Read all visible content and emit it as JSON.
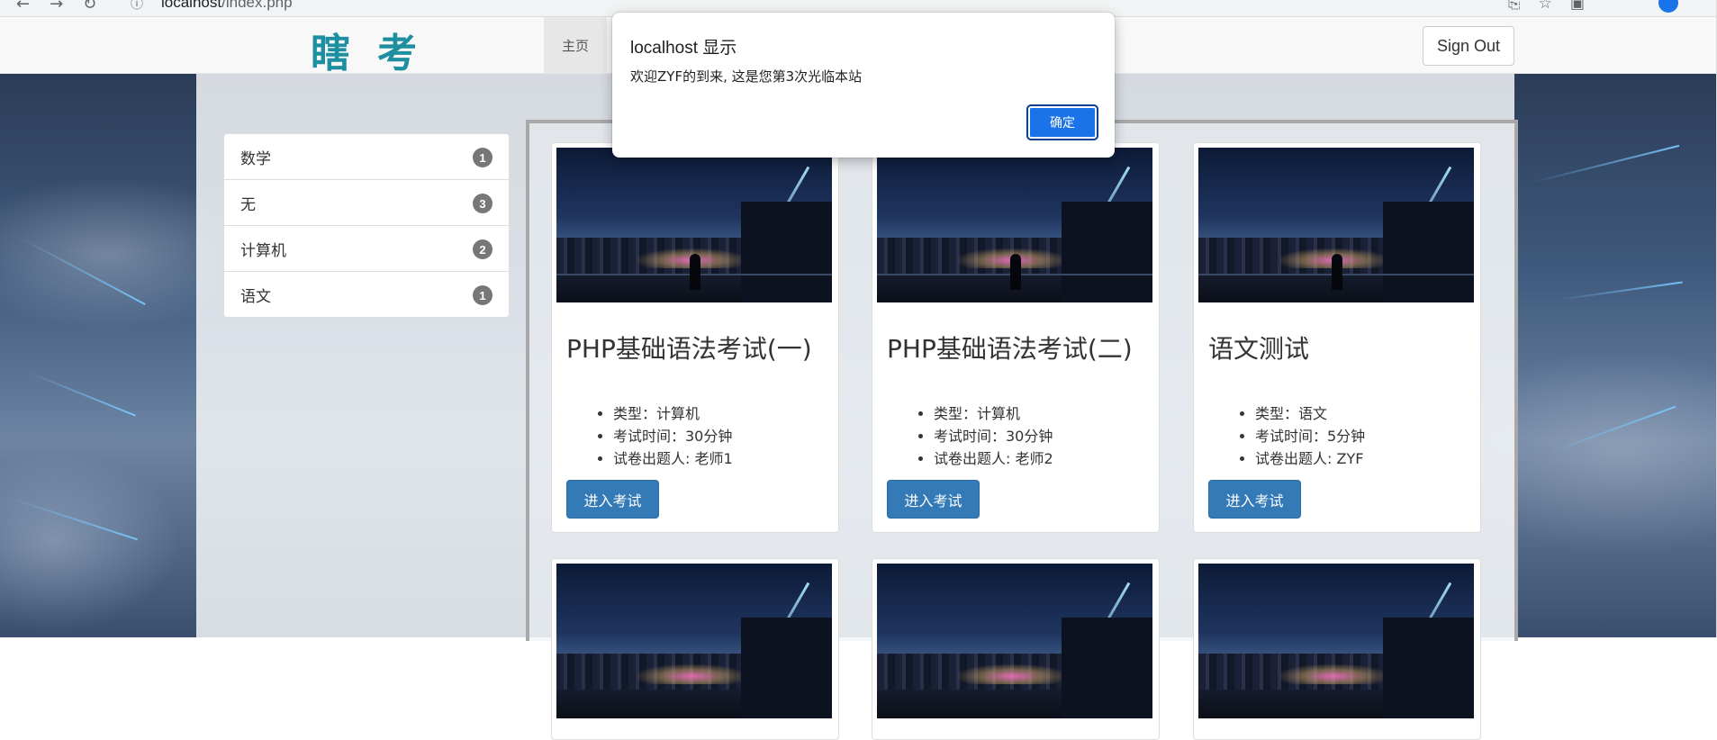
{
  "browser": {
    "url_host": "localhost",
    "url_path": "/index.php"
  },
  "navbar": {
    "brand": "瞎考",
    "home_label": "主页",
    "signout_label": "Sign Out"
  },
  "sidebar": {
    "items": [
      {
        "label": "数学",
        "count": "1"
      },
      {
        "label": "无",
        "count": "3"
      },
      {
        "label": "计算机",
        "count": "2"
      },
      {
        "label": "语文",
        "count": "1"
      }
    ]
  },
  "exams": [
    {
      "title": "PHP基础语法考试(一)",
      "type": "类型：计算机",
      "duration": "考试时间：30分钟",
      "author": "试卷出题人: 老师1",
      "button": "进入考试"
    },
    {
      "title": "PHP基础语法考试(二)",
      "type": "类型：计算机",
      "duration": "考试时间：30分钟",
      "author": "试卷出题人: 老师2",
      "button": "进入考试"
    },
    {
      "title": "语文测试",
      "type": "类型：语文",
      "duration": "考试时间：5分钟",
      "author": "试卷出题人: ZYF",
      "button": "进入考试"
    }
  ],
  "dialog": {
    "title": "localhost 显示",
    "message": "欢迎ZYF的到来, 这是您第3次光临本站",
    "ok_label": "确定"
  },
  "colors": {
    "primary_button": "#337ab7",
    "dialog_button": "#1a73e8",
    "brand": "#1d8fa0"
  }
}
